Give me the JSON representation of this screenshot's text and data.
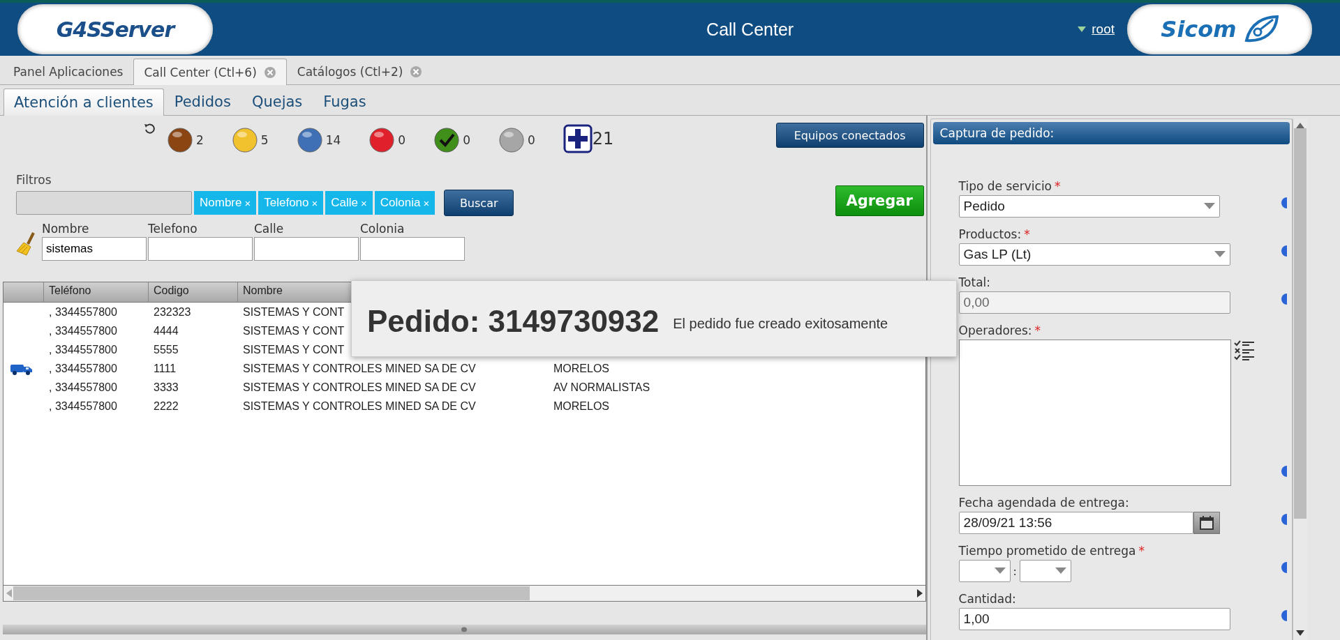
{
  "header": {
    "logo_left": "G4SServer",
    "title": "Call Center",
    "user": "root",
    "logo_right": "Sicom"
  },
  "app_tabs": [
    {
      "label": "Panel Aplicaciones",
      "selected": false,
      "closable": false
    },
    {
      "label": "Call Center (Ctl+6)",
      "selected": true,
      "closable": true
    },
    {
      "label": "Catálogos (Ctl+2)",
      "selected": false,
      "closable": true
    }
  ],
  "sub_tabs": [
    {
      "label": "Atención a clientes",
      "selected": true
    },
    {
      "label": "Pedidos",
      "selected": false
    },
    {
      "label": "Quejas",
      "selected": false
    },
    {
      "label": "Fugas",
      "selected": false
    }
  ],
  "status_counters": [
    {
      "kind": "ball",
      "color": "#8b4513",
      "count": "2"
    },
    {
      "kind": "ball",
      "color": "#f2c12e",
      "count": "5"
    },
    {
      "kind": "ball",
      "color": "#3f6fb5",
      "count": "14"
    },
    {
      "kind": "ball",
      "color": "#e0202a",
      "count": "0"
    },
    {
      "kind": "check",
      "color": "#3f8f1a",
      "count": "0"
    },
    {
      "kind": "ball",
      "color": "#a6a6a6",
      "count": "0"
    },
    {
      "kind": "plus",
      "color": "#1a237e",
      "count": "21"
    }
  ],
  "equipos_button": "Equipos conectados",
  "filters": {
    "label": "Filtros",
    "chips": [
      {
        "label": "Nombre",
        "remove": "×"
      },
      {
        "label": "Telefono",
        "remove": "×"
      },
      {
        "label": "Calle",
        "remove": "×"
      },
      {
        "label": "Colonia",
        "remove": "×"
      }
    ],
    "search_button": "Buscar"
  },
  "add_button": "Agregar",
  "search_fields": [
    {
      "label": "Nombre",
      "value": "sistemas"
    },
    {
      "label": "Telefono"
    },
    {
      "label": "Calle"
    },
    {
      "label": "Colonia"
    }
  ],
  "table": {
    "columns": [
      "Teléfono",
      "Codigo",
      "Nombre"
    ],
    "rows": [
      {
        "truck_icon": false,
        "cells": [
          ", 3344557800",
          "232323",
          "SISTEMAS Y CONT"
        ]
      },
      {
        "truck_icon": false,
        "cells": [
          ", 3344557800",
          "4444",
          "SISTEMAS Y CONT"
        ]
      },
      {
        "truck_icon": false,
        "cells": [
          ", 3344557800",
          "5555",
          "SISTEMAS Y CONT"
        ]
      },
      {
        "truck_icon": true,
        "cells": [
          ", 3344557800",
          "1111",
          "SISTEMAS Y CONTROLES MINED SA DE CV",
          "MORELOS"
        ]
      },
      {
        "truck_icon": false,
        "cells": [
          ", 3344557800",
          "3333",
          "SISTEMAS Y CONTROLES MINED SA DE CV",
          "AV NORMALISTAS"
        ]
      },
      {
        "truck_icon": false,
        "cells": [
          ", 3344557800",
          "2222",
          "SISTEMAS Y CONTROLES MINED SA DE CV",
          "MORELOS"
        ]
      }
    ]
  },
  "toast": {
    "title": "Pedido: 3149730932",
    "message": "El pedido fue creado exitosamente"
  },
  "order_panel": {
    "title": "Captura de pedido:",
    "required_mark": "*",
    "fields": [
      {
        "kind": "select",
        "label": "Tipo de servicio",
        "required": true,
        "disabled": false,
        "value": "Pedido"
      },
      {
        "kind": "select",
        "label": "Productos:",
        "required": true,
        "disabled": false,
        "value": "Gas LP (Lt)"
      },
      {
        "kind": "text",
        "label": "Total:",
        "required": false,
        "disabled": true,
        "value": "0,00"
      },
      {
        "kind": "list",
        "label": "Operadores:",
        "required": true,
        "disabled": false
      },
      {
        "kind": "date",
        "label": "Fecha agendada de entrega:",
        "required": false,
        "disabled": false,
        "value": "28/09/21 13:56"
      },
      {
        "kind": "time",
        "label": "Tiempo prometido de entrega",
        "required": true,
        "disabled": false,
        "separator": ":"
      },
      {
        "kind": "text",
        "label": "Cantidad:",
        "required": false,
        "disabled": false,
        "value": "1,00"
      }
    ]
  }
}
